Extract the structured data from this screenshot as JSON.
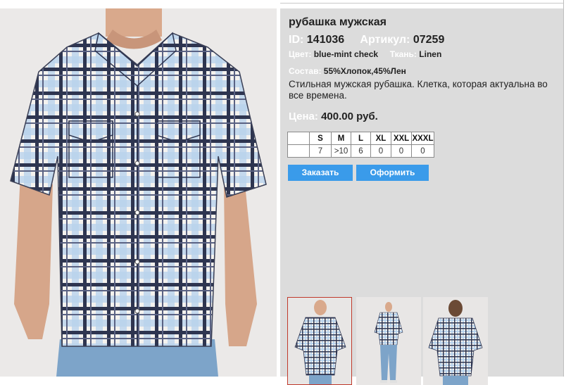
{
  "product": {
    "title": "рубашка мужская",
    "id_label": "ID:",
    "id_value": "141036",
    "article_label": "Артикул:",
    "article_value": "07259",
    "color_label": "Цвет:",
    "color_value": "blue-mint check",
    "fabric_label": "Ткань:",
    "fabric_value": "Linen",
    "composition_label": "Состав:",
    "composition_value": "55%Хлопок,45%Лен",
    "description": "Стильная мужская рубашка. Клетка, которая актуальна во все времена.",
    "price_label": "Цена:",
    "price_value": "400.00 руб."
  },
  "sizes": {
    "headers": [
      "",
      "S",
      "M",
      "L",
      "XL",
      "XXL",
      "XXXL"
    ],
    "stock": [
      "",
      "7",
      ">10",
      "6",
      "0",
      "0",
      "0"
    ]
  },
  "buttons": {
    "order": "Заказать",
    "checkout": "Оформить"
  },
  "colors": {
    "panel": "#dcdcdc",
    "label": "#ffffff",
    "button": "#3a9bea",
    "selected_border": "#c0392b"
  },
  "images": {
    "main": "main-shirt-photo",
    "thumbs": [
      "front-thumb",
      "full-body-thumb",
      "back-thumb"
    ]
  }
}
